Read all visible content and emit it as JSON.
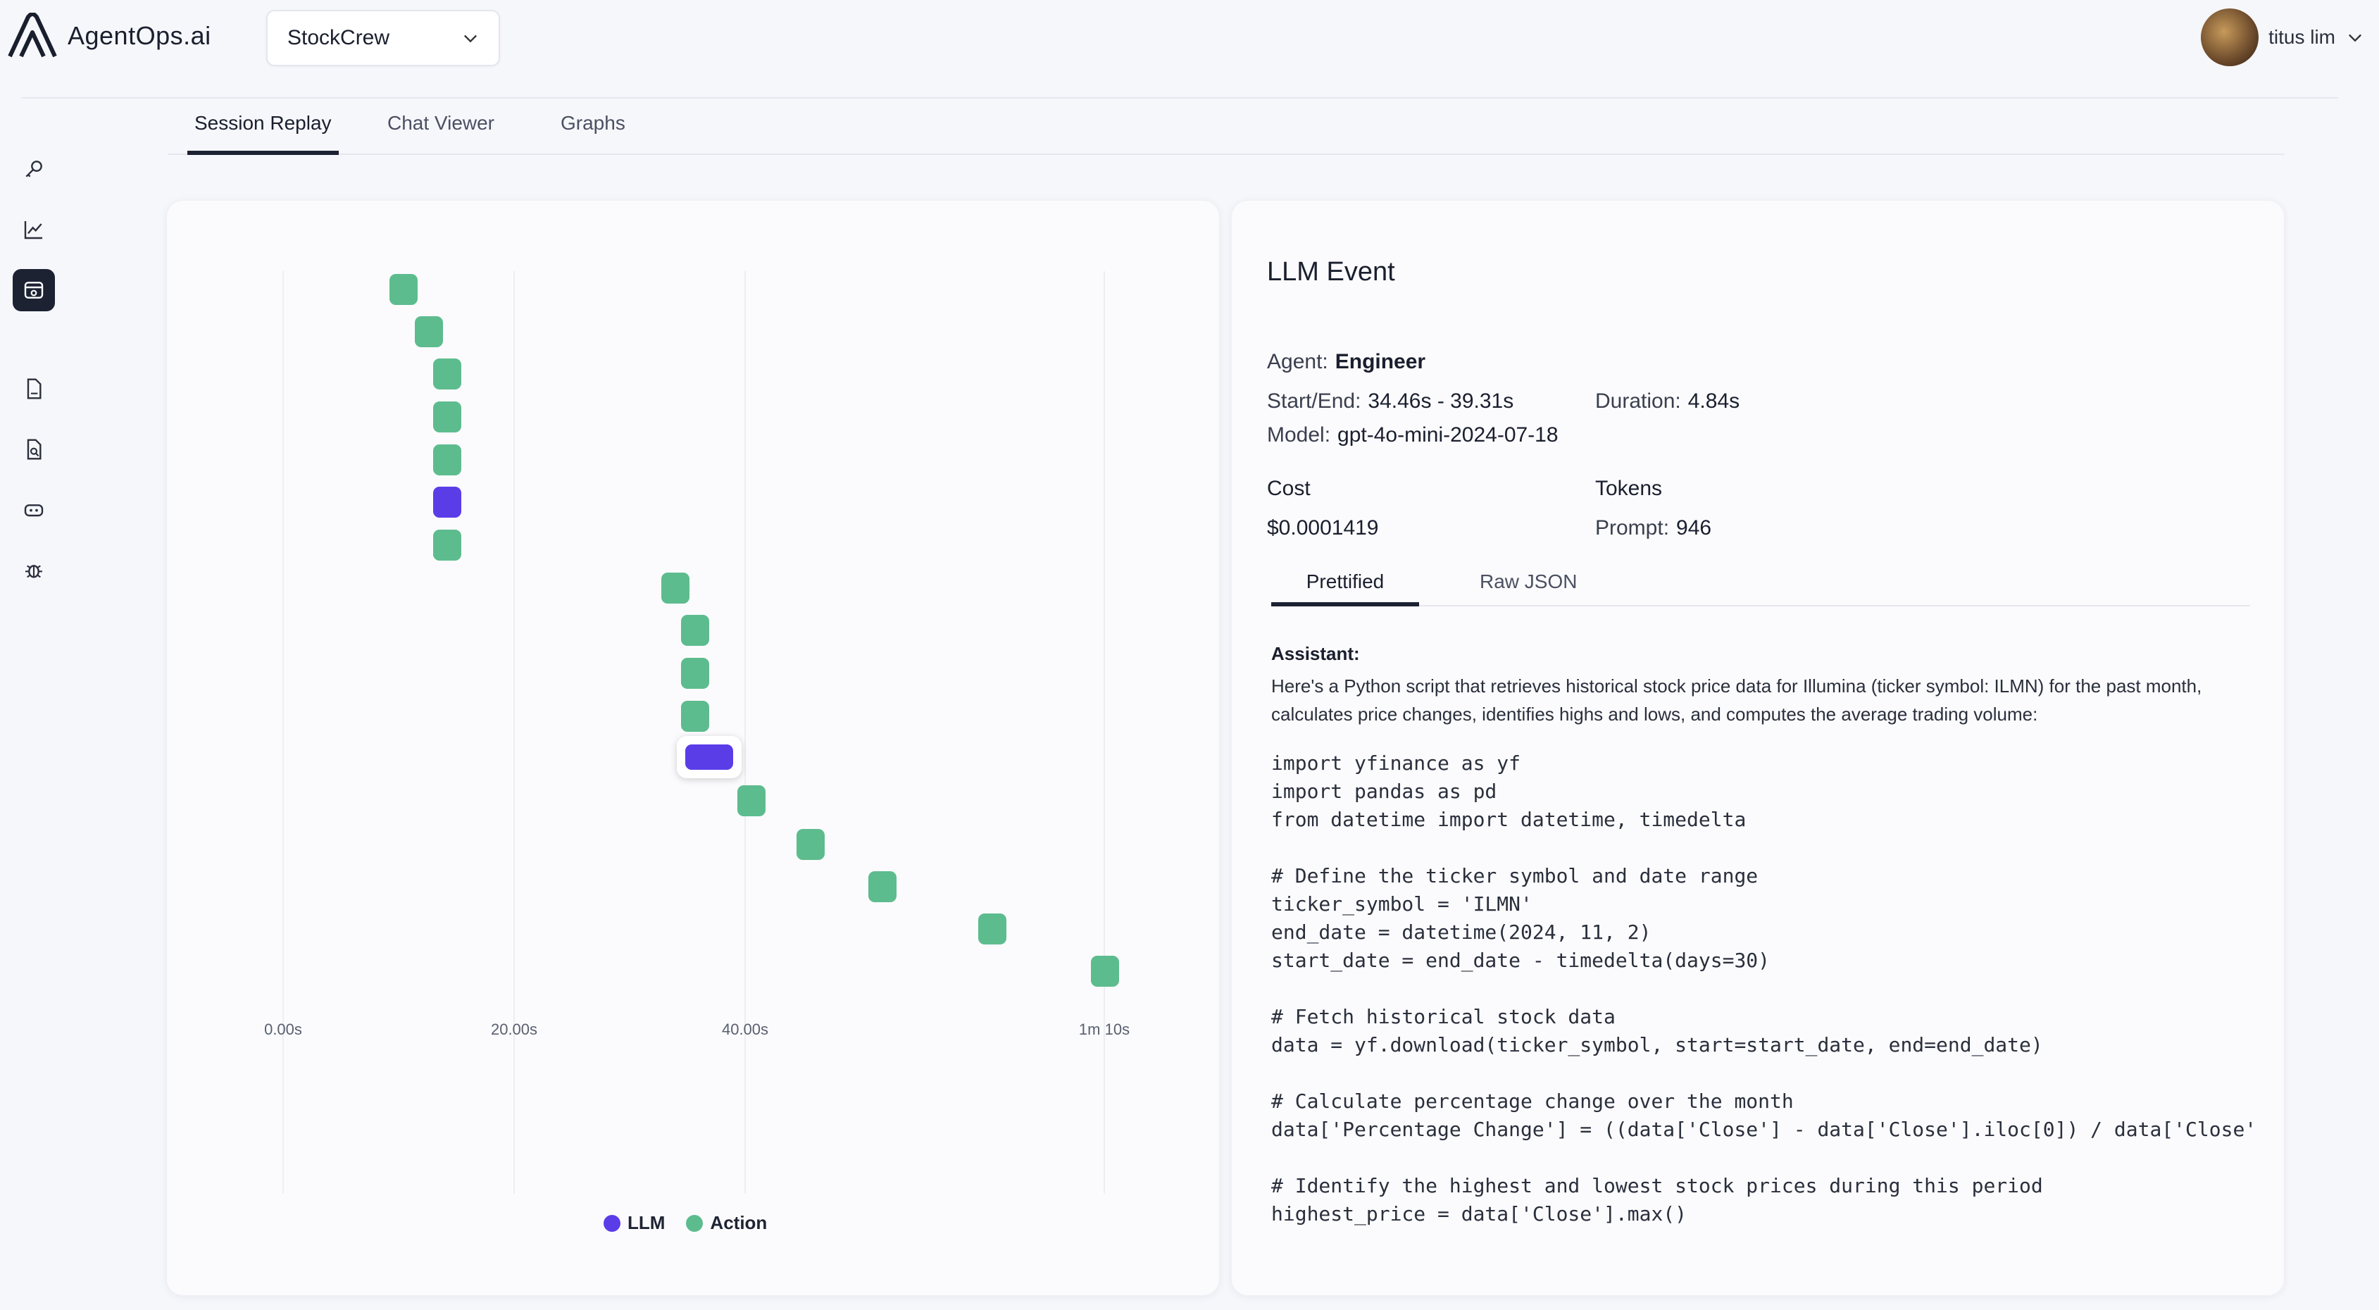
{
  "app": {
    "logo_text": "AgentOps.ai",
    "project": "StockCrew",
    "user_name": "titus lim"
  },
  "sidebar": {
    "items": [
      {
        "icon": "key-icon"
      },
      {
        "icon": "chart-line-icon"
      },
      {
        "icon": "session-replay-icon",
        "active": true
      },
      {
        "icon": "document-icon"
      },
      {
        "icon": "document-search-icon"
      },
      {
        "icon": "gamepad-icon"
      },
      {
        "icon": "bug-icon"
      }
    ]
  },
  "tabs": [
    "Session Replay",
    "Chat Viewer",
    "Graphs"
  ],
  "timeline": {
    "ticks": [
      "0.00s",
      "20.00s",
      "40.00s",
      "1m 10s"
    ],
    "legend": [
      {
        "label": "LLM",
        "color": "#5b3de8"
      },
      {
        "label": "Action",
        "color": "#5dbc8e"
      }
    ]
  },
  "event": {
    "title": "LLM Event",
    "agent_label": "Agent:",
    "agent": "Engineer",
    "startend_label": "Start/End:",
    "startend": "34.46s - 39.31s",
    "duration_label": "Duration:",
    "duration": "4.84s",
    "model_label": "Model:",
    "model": "gpt-4o-mini-2024-07-18",
    "cost_label": "Cost",
    "cost": "$0.0001419",
    "tokens_label": "Tokens",
    "prompt_label": "Prompt:",
    "prompt": "946",
    "subtabs": [
      "Prettified",
      "Raw JSON"
    ],
    "assistant_label": "Assistant:",
    "description": "Here's a Python script that retrieves historical stock price data for Illumina (ticker symbol: ILMN) for the past month, calculates price changes, identifies highs and lows, and computes the average trading volume:",
    "code": "import yfinance as yf\nimport pandas as pd\nfrom datetime import datetime, timedelta\n\n# Define the ticker symbol and date range\nticker_symbol = 'ILMN'\nend_date = datetime(2024, 11, 2)\nstart_date = end_date - timedelta(days=30)\n\n# Fetch historical stock data\ndata = yf.download(ticker_symbol, start=start_date, end=end_date)\n\n# Calculate percentage change over the month\ndata['Percentage Change'] = ((data['Close'] - data['Close'].iloc[0]) / data['Close'\n\n# Identify the highest and lowest stock prices during this period\nhighest_price = data['Close'].max()"
  }
}
